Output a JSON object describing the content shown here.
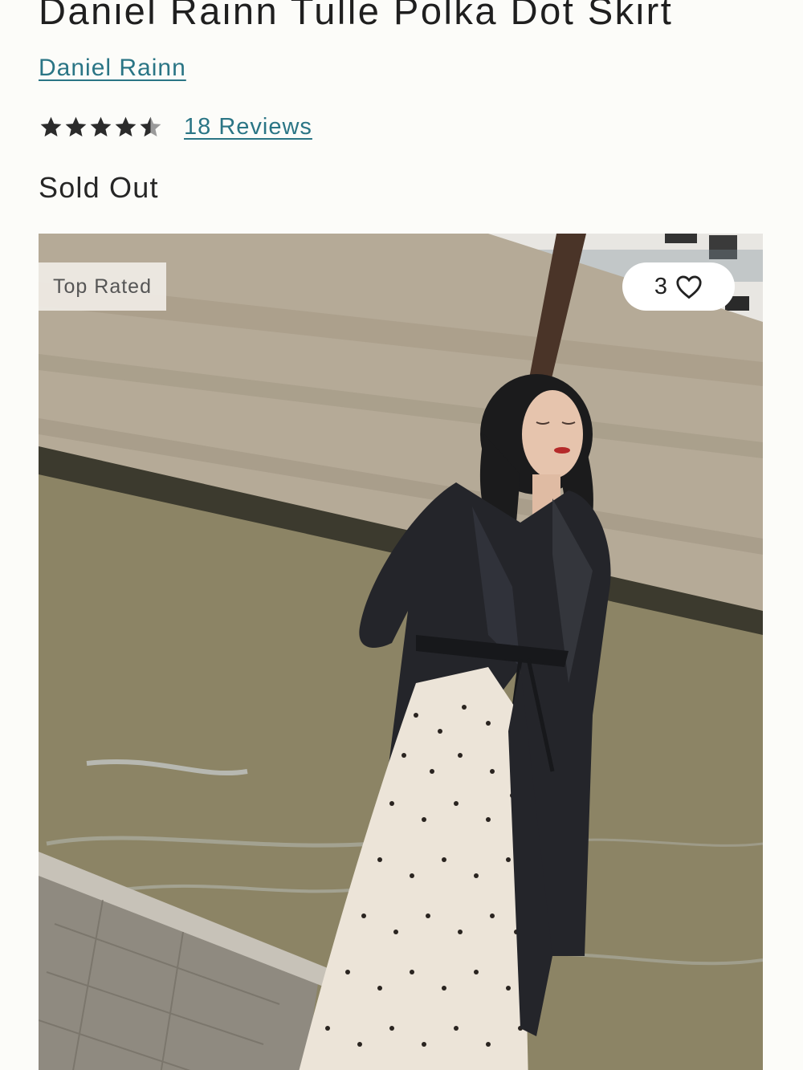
{
  "product": {
    "title": "Daniel Rainn Tulle Polka Dot Skirt",
    "brand": "Daniel Rainn",
    "rating": 4.5,
    "rating_max": 5,
    "reviews_label": "18 Reviews",
    "status": "Sold Out"
  },
  "image": {
    "badge": "Top Rated",
    "likes": "3"
  },
  "icons": {
    "star": "star-icon",
    "heart": "heart-outline-icon"
  },
  "colors": {
    "link": "#2a7585",
    "text": "#222222",
    "background": "#fcfcf9"
  }
}
